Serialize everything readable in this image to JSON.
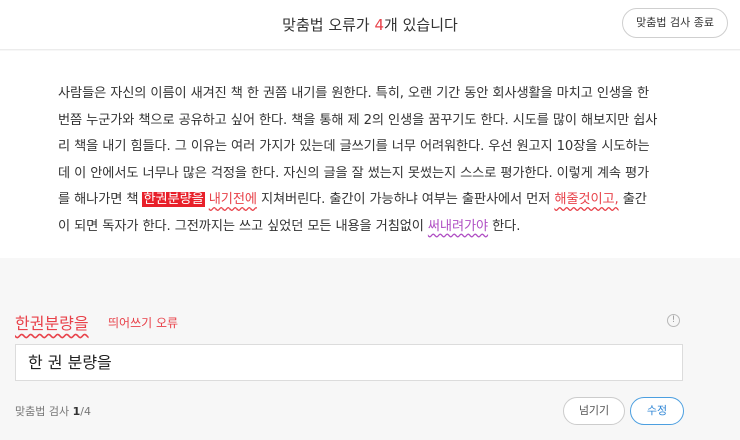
{
  "header": {
    "title_prefix": "맞춤법 오류가 ",
    "error_count": "4",
    "title_suffix": "개 있습니다",
    "end_button_label": "맞춤법 검사 종료"
  },
  "document": {
    "lines": [
      "사람들은 자신의 이름이 새겨진 책 한 권쯤 내기를 원한다. 특히, 오랜 기간 동안 회사생활을 마치고 인생을 한",
      "번쯤 누군가와 책으로 공유하고 싶어 한다. 책을 통해 제 2의 인생을 꿈꾸기도 한다. 시도를 많이 해보지만 쉽사",
      "리 책을 내기 힘들다. 그 이유는 여러 가지가 있는데 글쓰기를 너무 어려워한다. 우선 원고지 10장을 시도하는",
      "데 이 안에서도 너무나 많은 걱정을 한다. 자신의 글을 잘 썼는지 못썼는지 스스로 평가한다. 이렇게 계속 평가"
    ],
    "line5_a": "를 해나가면 책 ",
    "error1": "한권분량을",
    "line5_b": " ",
    "error2": "내기전에",
    "line5_c": " 지쳐버린다. 출간이 가능하냐 여부는 출판사에서 먼저 ",
    "error3": "해줄것이고,",
    "line5_d": " 출간",
    "line6_a": "이 되면 독자가 한다. 그전까지는 쓰고 싶었던 모든 내용을 거침없이 ",
    "error4": "써내려가야",
    "line6_b": " 한다."
  },
  "correction": {
    "error_word": "한권분량을",
    "error_type": "띄어쓰기 오류",
    "suggestion": "한 권 분량을",
    "info_icon_glyph": "!",
    "progress_label": "맞춤법 검사 ",
    "progress_current": "1",
    "progress_total": "/4",
    "skip_label": "넘기기",
    "fix_label": "수정"
  },
  "colors": {
    "error_red": "#e8424a",
    "spacing_purple": "#b04fc4",
    "accent_blue": "#2f86d6"
  }
}
